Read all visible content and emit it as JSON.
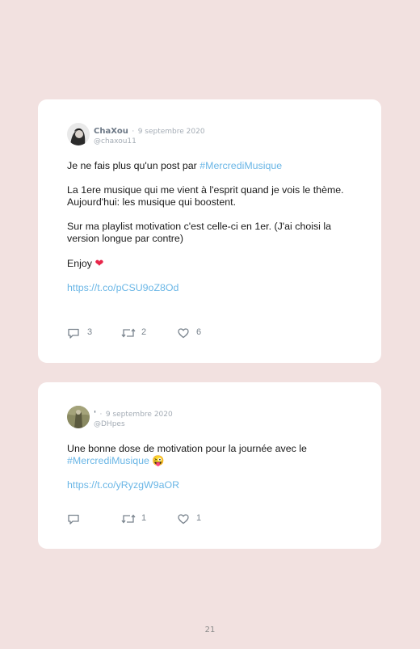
{
  "tweets": [
    {
      "name": "ChaXou",
      "separator": "·",
      "date": "9 septembre 2020",
      "handle": "@chaxou11",
      "p1_text": "Je ne fais plus qu'un post par ",
      "p1_tag": "#MercrediMusique",
      "p2_line1": "La 1ere musique qui me vient à l'esprit quand je vois le thème.",
      "p2_line2": "Aujourd'hui: les musique qui boostent.",
      "p3": "Sur ma playlist motivation c'est celle-ci en 1er. (J'ai choisi la version longue par contre)",
      "p4_text": "Enjoy ",
      "p4_emoji": "❤",
      "link": "https://t.co/pCSU9oZ8Od",
      "replies": "3",
      "retweets": "2",
      "likes": "6"
    },
    {
      "name": "'",
      "separator": "·",
      "date": "9 septembre 2020",
      "handle": "@DHpes",
      "p1_text": "Une bonne dose de motivation pour la journée avec le ",
      "p1_tag": "#MercrediMusique",
      "p1_emoji": "😜",
      "link": "https://t.co/yRyzgW9aOR",
      "replies": "",
      "retweets": "1",
      "likes": "1"
    }
  ],
  "page_number": "21",
  "colors": {
    "background": "#f2e1e0",
    "card": "#ffffff",
    "link": "#6ab6e6",
    "heart": "#e8264a",
    "meta": "#a4acb5"
  },
  "icons": [
    "reply-icon",
    "retweet-icon",
    "like-icon",
    "heart-emoji-icon",
    "winking-tongue-emoji-icon"
  ]
}
